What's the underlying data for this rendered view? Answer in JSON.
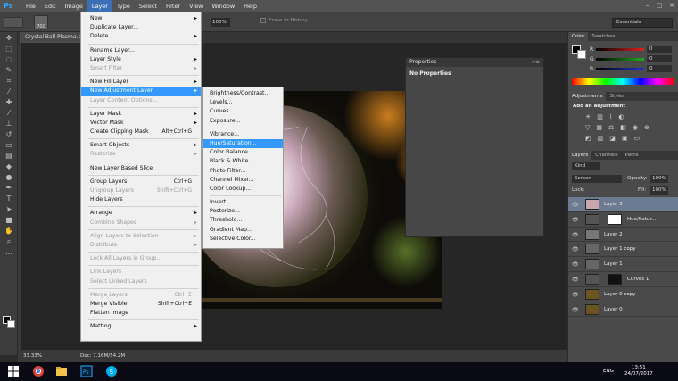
{
  "app": {
    "logo": "Ps"
  },
  "menubar": {
    "items": [
      "File",
      "Edit",
      "Image",
      "Layer",
      "Type",
      "Select",
      "Filter",
      "View",
      "Window",
      "Help"
    ],
    "active": "Layer"
  },
  "options": {
    "brush_size": "700",
    "zoom": "100%",
    "erase_to_history": "Erase to History",
    "workspace": "Essentials"
  },
  "document": {
    "tab": "Crystal Ball Plasma.p",
    "zoom_status": "33.33%",
    "doc_size": "Doc: 7.16M/54.2M"
  },
  "layer_menu": [
    {
      "label": "New",
      "arrow": true
    },
    {
      "label": "Duplicate Layer..."
    },
    {
      "label": "Delete",
      "arrow": true
    },
    {
      "sep": true
    },
    {
      "label": "Rename Layer..."
    },
    {
      "label": "Layer Style",
      "arrow": true
    },
    {
      "label": "Smart Filter",
      "arrow": true,
      "disabled": true
    },
    {
      "sep": true
    },
    {
      "label": "New Fill Layer",
      "arrow": true
    },
    {
      "label": "New Adjustment Layer",
      "arrow": true,
      "highlight": true
    },
    {
      "label": "Layer Content Options...",
      "disabled": true
    },
    {
      "sep": true
    },
    {
      "label": "Layer Mask",
      "arrow": true
    },
    {
      "label": "Vector Mask",
      "arrow": true
    },
    {
      "label": "Create Clipping Mask",
      "shortcut": "Alt+Ctrl+G"
    },
    {
      "sep": true
    },
    {
      "label": "Smart Objects",
      "arrow": true
    },
    {
      "label": "Rasterize",
      "arrow": true,
      "disabled": true
    },
    {
      "sep": true
    },
    {
      "label": "New Layer Based Slice"
    },
    {
      "sep": true
    },
    {
      "label": "Group Layers",
      "shortcut": "Ctrl+G"
    },
    {
      "label": "Ungroup Layers",
      "shortcut": "Shift+Ctrl+G",
      "disabled": true
    },
    {
      "label": "Hide Layers"
    },
    {
      "sep": true
    },
    {
      "label": "Arrange",
      "arrow": true
    },
    {
      "label": "Combine Shapes",
      "arrow": true,
      "disabled": true
    },
    {
      "sep": true
    },
    {
      "label": "Align Layers to Selection",
      "arrow": true,
      "disabled": true
    },
    {
      "label": "Distribute",
      "arrow": true,
      "disabled": true
    },
    {
      "sep": true
    },
    {
      "label": "Lock All Layers in Group...",
      "disabled": true
    },
    {
      "sep": true
    },
    {
      "label": "Link Layers",
      "disabled": true
    },
    {
      "label": "Select Linked Layers",
      "disabled": true
    },
    {
      "sep": true
    },
    {
      "label": "Merge Layers",
      "shortcut": "Ctrl+E",
      "disabled": true
    },
    {
      "label": "Merge Visible",
      "shortcut": "Shift+Ctrl+E"
    },
    {
      "label": "Flatten Image"
    },
    {
      "sep": true
    },
    {
      "label": "Matting",
      "arrow": true
    }
  ],
  "adjust_menu": [
    {
      "label": "Brightness/Contrast..."
    },
    {
      "label": "Levels..."
    },
    {
      "label": "Curves..."
    },
    {
      "label": "Exposure..."
    },
    {
      "sep": true
    },
    {
      "label": "Vibrance..."
    },
    {
      "label": "Hue/Saturation...",
      "highlight": true
    },
    {
      "label": "Color Balance..."
    },
    {
      "label": "Black & White..."
    },
    {
      "label": "Photo Filter..."
    },
    {
      "label": "Channel Mixer..."
    },
    {
      "label": "Color Lookup..."
    },
    {
      "sep": true
    },
    {
      "label": "Invert..."
    },
    {
      "label": "Posterize..."
    },
    {
      "label": "Threshold..."
    },
    {
      "label": "Gradient Map..."
    },
    {
      "label": "Selective Color..."
    }
  ],
  "properties": {
    "title": "Properties",
    "body": "No Properties"
  },
  "color_panel": {
    "tabs": [
      "Color",
      "Swatches"
    ],
    "channels": [
      {
        "label": "R",
        "value": "0",
        "color": "#d22"
      },
      {
        "label": "G",
        "value": "0",
        "color": "#2a2"
      },
      {
        "label": "B",
        "value": "0",
        "color": "#23c"
      }
    ]
  },
  "adjustments_panel": {
    "tabs": [
      "Adjustments",
      "Styles"
    ],
    "hint": "Add an adjustment"
  },
  "layers_panel": {
    "tabs": [
      "Layers",
      "Channels",
      "Paths"
    ],
    "kind": "Kind",
    "blend_mode": "Screen",
    "opacity_label": "Opacity:",
    "opacity": "100%",
    "lock_label": "Lock:",
    "fill_label": "Fill:",
    "fill": "100%",
    "layers": [
      {
        "name": "Layer 3",
        "selected": true,
        "thumb": "#c9a6ad"
      },
      {
        "name": "Hue/Satur...",
        "adjust": true,
        "thumb": "#555",
        "mask": "#fff"
      },
      {
        "name": "Layer 2",
        "thumb": "#777"
      },
      {
        "name": "Layer 1 copy",
        "thumb": "#666"
      },
      {
        "name": "Layer 1",
        "thumb": "#666"
      },
      {
        "name": "Curves 1",
        "adjust": true,
        "thumb": "#555",
        "mask": "#111"
      },
      {
        "name": "Layer 0 copy",
        "thumb": "#6a5420"
      },
      {
        "name": "Layer 0",
        "thumb": "#6a5420"
      }
    ]
  },
  "taskbar": {
    "language": "ENG",
    "time": "13:51",
    "date": "24/07/2017"
  }
}
